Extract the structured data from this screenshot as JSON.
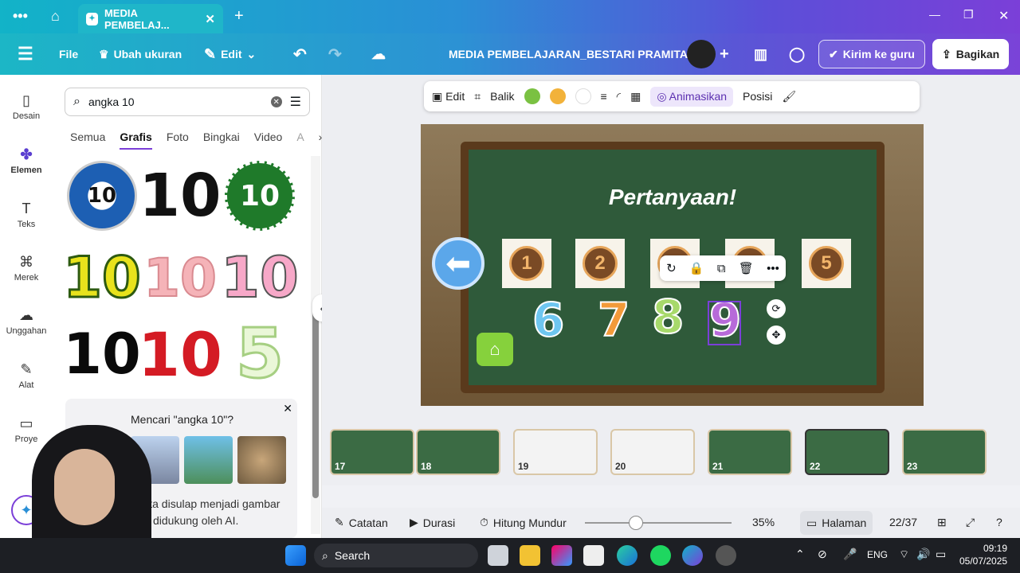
{
  "browser": {
    "tab_title": "MEDIA PEMBELAJ...",
    "tab_close": "✕",
    "new_tab": "+",
    "window_controls": [
      "—",
      "❐",
      "✕"
    ]
  },
  "toolbar": {
    "file": "File",
    "resize": "Ubah ukuran",
    "edit": "Edit",
    "doc_title": "MEDIA PEMBELAJARAN_BESTARI PRAMITA",
    "send_teacher": "Kirim ke guru",
    "share": "Bagikan"
  },
  "rail": [
    {
      "label": "Desain",
      "icon": "design-icon"
    },
    {
      "label": "Elemen",
      "icon": "elements-icon"
    },
    {
      "label": "Teks",
      "icon": "text-icon"
    },
    {
      "label": "Merek",
      "icon": "brand-icon"
    },
    {
      "label": "Unggahan",
      "icon": "upload-icon"
    },
    {
      "label": "Alat",
      "icon": "tools-icon"
    },
    {
      "label": "Proye",
      "icon": "folder-icon"
    }
  ],
  "search": {
    "value": "angka 10"
  },
  "categories": [
    "Semua",
    "Grafis",
    "Foto",
    "Bingkai",
    "Video",
    "A"
  ],
  "grid": [
    {
      "text": "10"
    },
    {
      "text": "10"
    },
    {
      "text": "10"
    },
    {
      "text": "10"
    },
    {
      "text": "10"
    },
    {
      "text": "10"
    },
    {
      "text": "10"
    },
    {
      "text": "10"
    },
    {
      "text": "5"
    }
  ],
  "promo": {
    "title": "Mencari \"angka 10\"?",
    "body_line1": "a-kata disulap menjadi gambar",
    "body_line2": "didukung oleh AI."
  },
  "context_toolbar": {
    "edit": "Edit",
    "flip": "Balik",
    "animate": "Animasikan",
    "position": "Posisi",
    "colors": [
      "#7ac142",
      "#f2b23a",
      "#ffffff"
    ]
  },
  "slide": {
    "title": "Pertanyaan!",
    "cards": [
      "1",
      "2",
      "3",
      "4",
      "5"
    ],
    "numbers": [
      "6",
      "7",
      "8",
      "9"
    ]
  },
  "thumbnails": [
    {
      "num": "17"
    },
    {
      "num": "18"
    },
    {
      "num": "19"
    },
    {
      "num": "20"
    },
    {
      "num": "21"
    },
    {
      "num": "22"
    },
    {
      "num": "23"
    }
  ],
  "bottom": {
    "notes": "Catatan",
    "duration": "Durasi",
    "countdown": "Hitung Mundur",
    "zoom": "35%",
    "zoom_level": 0.35,
    "page_view": "Halaman",
    "page": "22/37"
  },
  "taskbar": {
    "search": "Search",
    "lang": "ENG",
    "time": "09:19",
    "date": "05/07/2025"
  }
}
